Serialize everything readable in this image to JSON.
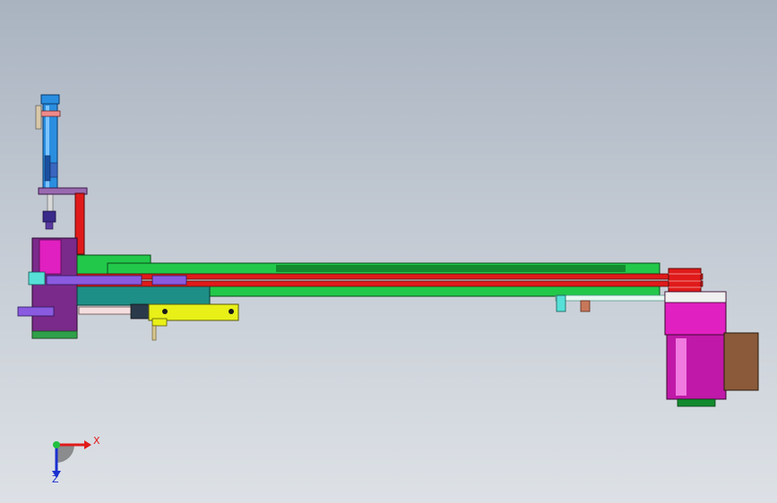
{
  "viewport": {
    "background_top": "#a9b3c0",
    "background_bottom": "#dde1e6"
  },
  "model": {
    "colors": {
      "cylinder_blue": "#2a8ee0",
      "magenta": "#e020c0",
      "purple": "#7a2a8a",
      "green": "#22c84a",
      "dark_green": "#138a2e",
      "red": "#e01a1a",
      "teal": "#1e8f86",
      "yellow": "#e8f018",
      "brown": "#8a5a3a",
      "cyan": "#56e0d8",
      "violet": "#8a5ae0"
    }
  },
  "triad": {
    "x_label": "X",
    "z_label": "Z",
    "x_color": "#e01a1a",
    "y_color": "#20c040",
    "z_color": "#1a30d0"
  }
}
